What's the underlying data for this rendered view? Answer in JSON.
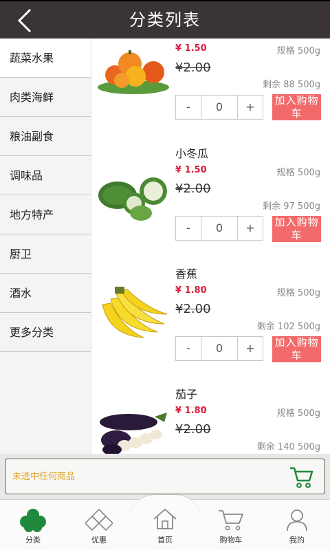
{
  "header": {
    "title": "分类列表",
    "back_icon": "back-arrow-icon"
  },
  "sidebar": {
    "items": [
      {
        "label": "蔬菜水果"
      },
      {
        "label": "肉类海鲜"
      },
      {
        "label": "粮油副食"
      },
      {
        "label": "调味品"
      },
      {
        "label": "地方特产"
      },
      {
        "label": "厨卫"
      },
      {
        "label": "酒水"
      },
      {
        "label": "更多分类"
      }
    ]
  },
  "products": [
    {
      "name": "",
      "price": "¥ 1.50",
      "spec": "规格 500g",
      "old_price": "¥2.00",
      "stock": "剩余 88 500g",
      "qty": "0",
      "minus": "-",
      "plus": "+",
      "add_label": "加入购物车",
      "image": "pumpkin-image"
    },
    {
      "name": "小冬瓜",
      "price": "¥ 1.50",
      "spec": "规格 500g",
      "old_price": "¥2.00",
      "stock": "剩余 97 500g",
      "qty": "0",
      "minus": "-",
      "plus": "+",
      "add_label": "加入购物车",
      "image": "winter-melon-image"
    },
    {
      "name": "香蕉",
      "price": "¥ 1.80",
      "spec": "规格 500g",
      "old_price": "¥2.00",
      "stock": "剩余 102 500g",
      "qty": "0",
      "minus": "-",
      "plus": "+",
      "add_label": "加入购物车",
      "image": "banana-image"
    },
    {
      "name": "茄子",
      "price": "¥ 1.80",
      "spec": "规格 500g",
      "old_price": "¥2.00",
      "stock": "剩余 140 500g",
      "image": "eggplant-image"
    }
  ],
  "cartbar": {
    "message": "未选中任何商品",
    "icon": "cart-icon"
  },
  "tabs": [
    {
      "label": "分类",
      "icon": "flower-icon",
      "active_color": "#1f8a3b"
    },
    {
      "label": "优惠",
      "icon": "diamonds-icon"
    },
    {
      "label": "首页",
      "icon": "home-icon"
    },
    {
      "label": "购物车",
      "icon": "cart-icon"
    },
    {
      "label": "我的",
      "icon": "user-icon"
    }
  ],
  "colors": {
    "header_bg": "#3b3434",
    "price_red": "#d81e3c",
    "add_button": "#f26a6a",
    "cart_message": "#e6a42a",
    "cart_green": "#1f8a3b"
  }
}
